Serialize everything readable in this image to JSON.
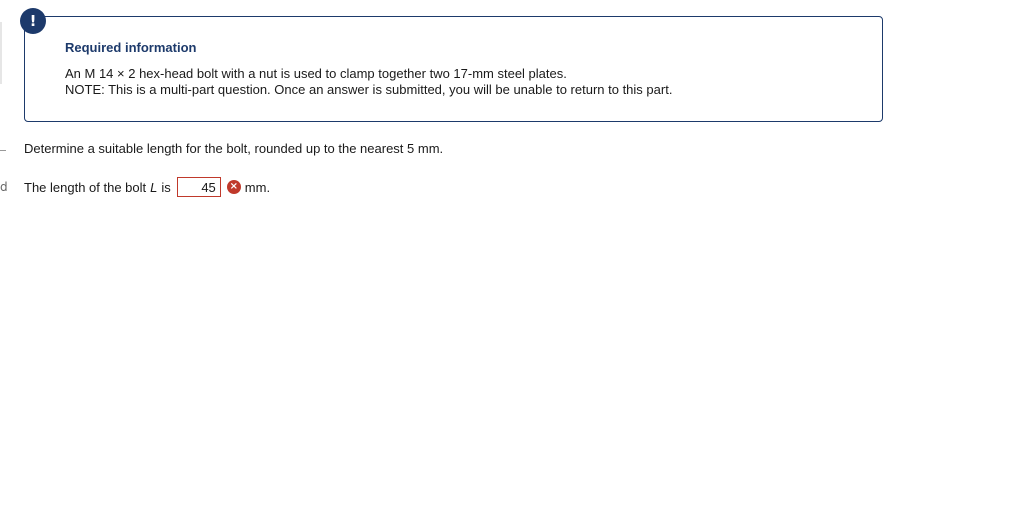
{
  "info": {
    "badge": "!",
    "title": "Required information",
    "line1": "An M 14 × 2 hex-head bolt with a nut is used to clamp together two 17-mm steel plates.",
    "line2": "NOTE: This is a multi-part question. Once an answer is submitted, you will be unable to return to this part."
  },
  "question": {
    "text": "Determine a suitable length for the bolt, rounded up to the nearest 5 mm."
  },
  "answer": {
    "prefix": "The length of the bolt",
    "variable": "L",
    "suffix": "is",
    "value": "45",
    "status_icon": "×",
    "unit": "mm."
  },
  "edge": {
    "mark": "d"
  },
  "colors": {
    "accent": "#1d3a6b",
    "error": "#c0392b"
  }
}
